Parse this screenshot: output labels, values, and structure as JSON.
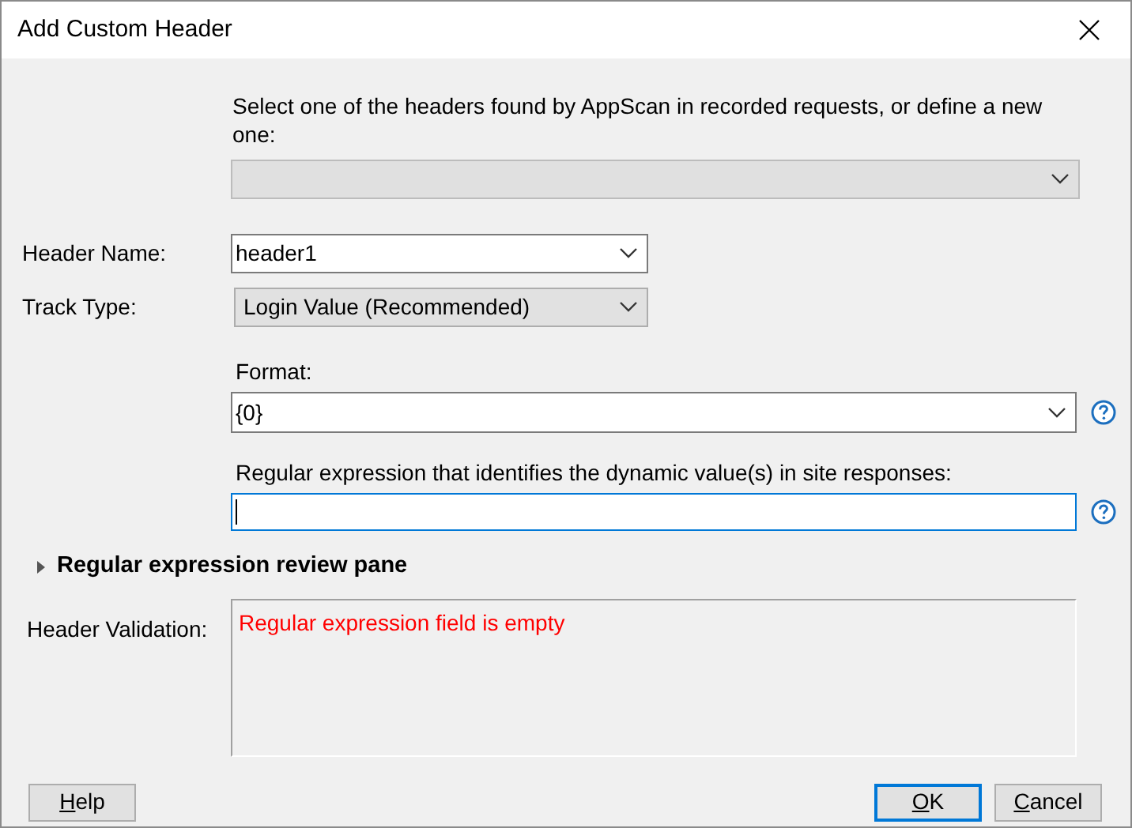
{
  "window": {
    "title": "Add Custom Header"
  },
  "header_picker": {
    "prompt": "Select one of the headers found by AppScan in recorded requests, or define a new one:",
    "disabled": true
  },
  "header_name": {
    "label": "Header Name:",
    "value": "header1"
  },
  "track_type": {
    "label": "Track Type:",
    "value": "Login Value (Recommended)"
  },
  "format": {
    "label": "Format:",
    "value": "{0}"
  },
  "regex": {
    "label": "Regular expression that identifies the dynamic value(s) in site responses:",
    "focused": true
  },
  "review_pane": {
    "label": "Regular expression review pane",
    "expanded": false
  },
  "validation": {
    "label": "Header Validation:",
    "message": "Regular expression field is empty"
  },
  "buttons": [
    {
      "label": "Help",
      "underline_first": true,
      "default": false
    },
    {
      "label": "OK",
      "underline_first": true,
      "default": true
    },
    {
      "label": "Cancel",
      "underline_first": true,
      "default": false
    }
  ]
}
